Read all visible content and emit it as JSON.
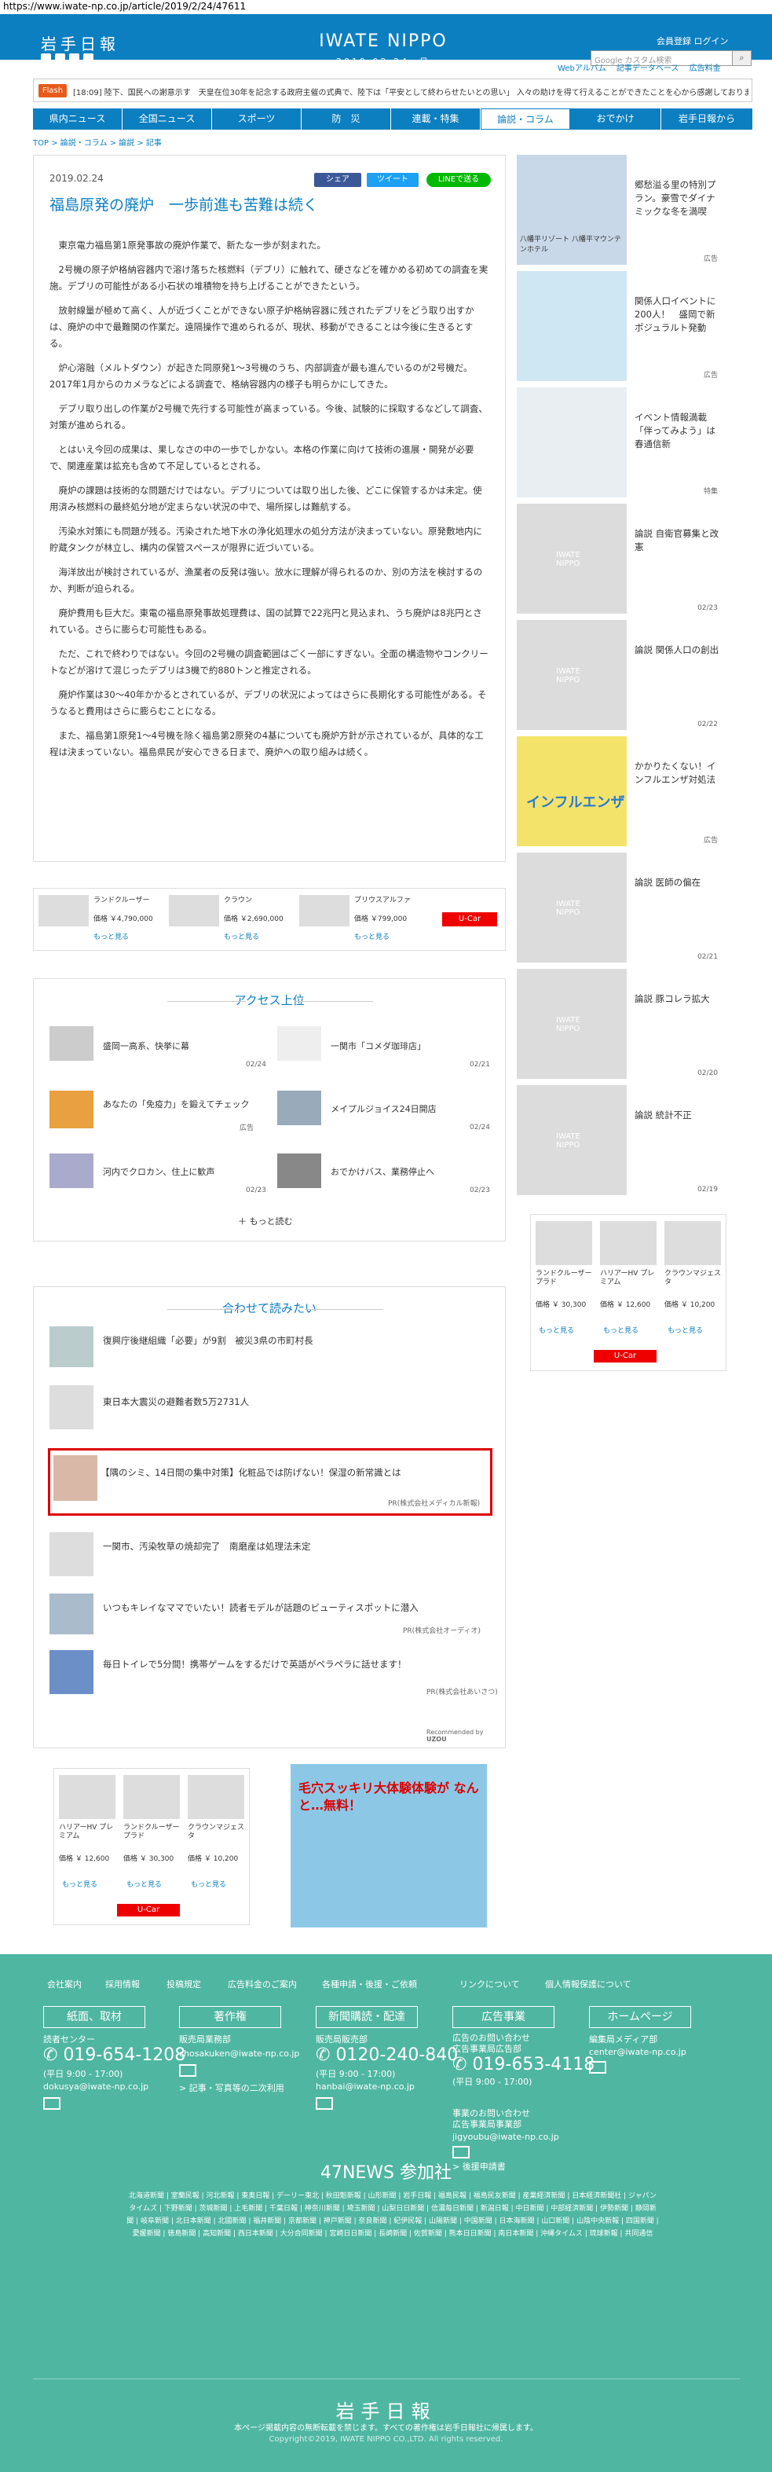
{
  "url": "https://www.iwate-np.co.jp/article/2019/2/24/47611",
  "header": {
    "logo": "岩手日報",
    "brand": "IWATE NIPPO",
    "date": "2019.02.24. 日",
    "member": "会員登録  ログイン",
    "search_placeholder": "Google カスタム検索",
    "search_button": "検索"
  },
  "subnav": [
    "Webアルバム",
    "記事データベース",
    "広告料金"
  ],
  "flash": {
    "tag": "Flash",
    "text": "[18:09] 陸下、国民への謝意示す　天皇在位30年を記念する政府主催の式典で、陸下は「平安として終わらせたいとの思い」 入々の助けを得て行えることができたことを心から感謝しております」"
  },
  "nav": [
    "県内ニュース",
    "全国ニュース",
    "スポーツ",
    "防　災",
    "連載・特集",
    "論説・コラム",
    "おでかけ",
    "岩手日報から"
  ],
  "breadcrumb": "TOP > 論説・コラム > 論説 > 記事",
  "article": {
    "date": "2019.02.24",
    "title": "福島原発の廃炉　一歩前進も苦難は続く",
    "share_fb": "シェア",
    "share_tw": "ツイート",
    "share_line": "LINEで送る",
    "paragraphs": [
      "東京電力福島第1原発事故の廃炉作業で、新たな一歩が刻まれた。",
      "2号機の原子炉格納容器内で溶け落ちた核燃料（デブリ）に触れて、硬さなどを確かめる初めての調査を実施。デブリの可能性がある小石状の堆積物を持ち上げることができたという。",
      "放射線量が極めて高く、人が近づくことができない原子炉格納容器に残されたデブリをどう取り出すかは、廃炉の中で最難関の作業だ。遠隔操作で進められるが、現状、移動ができることは今後に生きるとする。",
      "炉心溶融（メルトダウン）が起きた同原発1～3号機のうち、内部調査が最も進んでいるのが2号機だ。2017年1月からのカメラなどによる調査で、格納容器内の様子も明らかにしてきた。",
      "デブリ取り出しの作業が2号機で先行する可能性が高まっている。今後、試験的に採取するなどして調査、対策が進められる。",
      "とはいえ今回の成果は、果しなさの中の一歩でしかない。本格の作業に向けて技術の進展・開発が必要で、関連産業は拡充も含めて不足しているとされる。",
      "廃炉の課題は技術的な問題だけではない。デブリについては取り出した後、どこに保管するかは未定。使用済み核燃料の最終処分地が定まらない状況の中で、場所探しは難航する。",
      "汚染水対策にも問題が残る。汚染された地下水の浄化処理水の処分方法が決まっていない。原発敷地内に貯蔵タンクが林立し、構内の保管スペースが限界に近づいている。",
      "海洋放出が検討されているが、漁業者の反発は強い。放水に理解が得られるのか、別の方法を検討するのか、判断が迫られる。",
      "廃炉費用も巨大だ。東電の福島原発事故処理費は、国の試算で22兆円と見込まれ、うち廃炉は8兆円とされている。さらに膨らむ可能性もある。",
      "ただ、これで終わりではない。今回の2号機の調査範囲はごく一部にすぎない。全面の構造物やコンクリートなどが溶けて混じったデブリは3機で約880トンと推定される。",
      "廃炉作業は30～40年かかるとされているが、デブリの状況によってはさらに長期化する可能性がある。そうなると費用はさらに膨らむことになる。",
      "また、福島第1原発1～4号機を除く福島第2原発の4基についても廃炉方針が示されているが、具体的な工程は決まっていない。福島県民が安心できる日まで、廃炉への取り組みは続く。"
    ]
  },
  "cars_ad_main": [
    {
      "name": "ランドクルーザー",
      "price": "価格 ￥4,790,000",
      "btn": "もっと見る"
    },
    {
      "name": "クラウン",
      "price": "価格 ￥2,690,000",
      "btn": "もっと見る"
    },
    {
      "name": "プリウスアルファ",
      "price": "価格 ￥799,000",
      "btn": "もっと見る"
    }
  ],
  "access": {
    "title": "アクセス上位",
    "items": [
      {
        "title": "盛岡一高系、快挙に幕",
        "date": "02/24"
      },
      {
        "title": "一関市「コメダ珈琲店」",
        "date": "02/21"
      },
      {
        "title": "あなたの「免疫力」を鍛えてチェック",
        "date": "広告"
      },
      {
        "title": "メイプルジョイス24日開店",
        "date": "02/24"
      },
      {
        "title": "河内でクロカン、住上に歓声",
        "date": "02/23"
      },
      {
        "title": "おでかけバス、業務停止へ",
        "date": "02/23"
      }
    ],
    "more": "もっと読む"
  },
  "related": {
    "title": "合わせて読みたい",
    "items": [
      {
        "title": "復興庁後継組織「必要」が9割　被災3県の市町村長",
        "pr": ""
      },
      {
        "title": "東日本大震災の避難者数5万2731人",
        "pr": ""
      },
      {
        "title": "【隅のシミ、14日間の集中対策】化粧品では防げない！保湿の新常識とは",
        "pr": "PR(株式会社メディカル新報)"
      },
      {
        "title": "一関市、汚染牧草の焼却完了　南磨産は処理法未定",
        "pr": ""
      },
      {
        "title": "いつもキレイなママでいたい！読者モデルが話題のビューティスポットに潜入",
        "pr": "PR(株式会社オーディオ)"
      },
      {
        "title": "毎日トイレで5分間！携帯ゲームをするだけで英語がペラペラに話せます！",
        "pr": "PR(株式会社あいさつ)"
      }
    ],
    "footer": "Recommended by"
  },
  "sidebar": [
    {
      "title": "郷愁溢る里の特別プラン。豪雪でダイナミックな冬を満喫",
      "date": "広告",
      "label": "八幡平リゾート 八幡平マウンテンホテル"
    },
    {
      "title": "関係人口イベントに200人！　盛岡で新ポジュラルト発動",
      "date": "広告"
    },
    {
      "title": "イベント情報満載「伴ってみよう」は春通信新",
      "date": "特集"
    },
    {
      "title": "論説 自衛官募集と改憲",
      "date": "02/23"
    },
    {
      "title": "論説 関係人口の創出",
      "date": "02/22"
    },
    {
      "title": "かかりたくない！インフルエンザ対処法",
      "date": "広告"
    },
    {
      "title": "論説 医師の偏在",
      "date": "02/21"
    },
    {
      "title": "論説 豚コレラ拡大",
      "date": "02/20"
    },
    {
      "title": "論説 統計不正",
      "date": "02/19"
    }
  ],
  "cars_ad_side": [
    {
      "name": "ランドクルーザープラド",
      "price": "価格 ￥ 30,300",
      "btn": "もっと見る"
    },
    {
      "name": "ハリアーHV プレミアム",
      "price": "価格 ￥ 12,600",
      "btn": "もっと見る"
    },
    {
      "name": "クラウンマジェスタ",
      "price": "価格 ￥ 10,200",
      "btn": "もっと見る"
    }
  ],
  "cars_ad_bottom": [
    {
      "name": "ハリアーHV プレミアム",
      "price": "価格 ￥ 12,600",
      "btn": "もっと見る"
    },
    {
      "name": "ランドクルーザープラド",
      "price": "価格 ￥ 30,300",
      "btn": "もっと見る"
    },
    {
      "name": "クラウンマジェスタ",
      "price": "価格 ￥ 10,200",
      "btn": "もっと見る"
    }
  ],
  "influenza_ad": "インフルエンザ",
  "pachinko_ad": "毛穴スッキリ大体験体験が なんと…無料！",
  "footer": {
    "links": [
      "会社案内",
      "採用情報",
      "投稿規定",
      "広告料金のご案内",
      "各種申請・後援・ご依頼",
      "リンクについて",
      "個人情報保護について"
    ],
    "heads": [
      "紙面、取材",
      "著作権",
      "新聞購読・配達",
      "広告事業",
      "ホームページ"
    ],
    "col1": {
      "label": "読者センター",
      "phone": "019-654-1208",
      "hours": "(平日 9:00 - 17:00)",
      "mail": "dokusya@iwate-np.co.jp"
    },
    "col2": {
      "label": "販売局業務部",
      "mail": "chosakuken@iwate-np.co.jp",
      "link": "> 記事・写真等の二次利用"
    },
    "col3": {
      "label": "販売局販売部",
      "phone": "0120-240-840",
      "hours": "(平日 9:00 - 17:00)",
      "mail": "hanbai@iwate-np.co.jp"
    },
    "col4": {
      "label1": "広告のお問い合わせ",
      "label2": "広告事業局広告部",
      "phone": "019-653-4118",
      "hours": "(平日 9:00 - 17:00)",
      "label3": "事業のお問い合わせ",
      "label4": "広告事業局事業部",
      "mail": "jigyoubu@iwate-np.co.jp",
      "link": "> 後援申請書"
    },
    "col5": {
      "label": "編集局メディア部",
      "mail": "center@iwate-np.co.jp"
    },
    "news47": "47NEWS 参加社",
    "newslist": "北海道新聞 | 室蘭民報 | 河北新報 | 東奥日報 | デーリー東北 | 秋田魁新報 | 山形新聞 | 岩手日報 | 福島民報 | 福島民友新聞 | 産業経済新聞 | 日本経済新聞社 | ジャパンタイムズ | 下野新聞 | 茨城新聞 | 上毛新聞 | 千葉日報 | 神奈川新聞 | 埼玉新聞 | 山梨日日新聞 | 信濃毎日新聞 | 新潟日報 | 中日新聞 | 中部経済新聞 | 伊勢新聞 | 静岡新聞 | 岐阜新聞 | 北日本新聞 | 北國新聞 | 福井新聞 | 京都新聞 | 神戸新聞 | 奈良新聞 | 紀伊民報 | 山陽新聞 | 中国新聞 | 日本海新聞 | 山口新聞 | 山陰中央新報 | 四国新聞 | 愛媛新聞 | 徳島新聞 | 高知新聞 | 西日本新聞 | 大分合同新聞 | 宮崎日日新聞 | 長崎新聞 | 佐賀新聞 | 熊本日日新聞 | 南日本新聞 | 沖縄タイムス | 琉球新報 | 共同通信",
    "logo": "岩手日報",
    "copy1": "本ページ掲載内容の無断転載を禁じます。すべての著作権は岩手日報社に帰属します。",
    "copy2": "Copyright©2019, IWATE NIPPO CO.,LTD. All rights reserved."
  }
}
